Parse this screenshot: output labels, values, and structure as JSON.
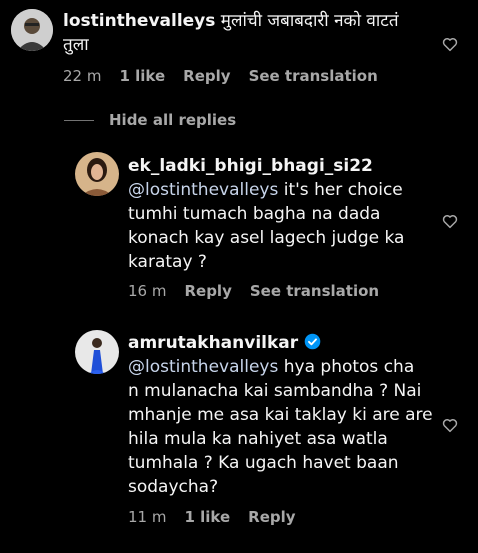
{
  "comment": {
    "username": "lostinthevalleys",
    "text_inline": "मुलांची जबाबदारी नको वाटतं",
    "text_line2": "तुला",
    "time": "22 m",
    "likes": "1 like",
    "reply_label": "Reply",
    "translate_label": "See translation"
  },
  "replies_toggle": {
    "label": "Hide all replies"
  },
  "replies": [
    {
      "username": "ek_ladki_bhigi_bhagi_si22",
      "mention": "@lostinthevalleys",
      "text_first": " it's her choice",
      "lines": [
        "tumhi tumach bagha na dada",
        "konach kay asel lagech judge ka",
        "karatay ?"
      ],
      "time": "16 m",
      "reply_label": "Reply",
      "translate_label": "See translation"
    },
    {
      "username": "amrutakhanvilkar",
      "verified": true,
      "mention": "@lostinthevalleys",
      "text_first": " hya photos cha",
      "lines": [
        "n mulanacha kai sambandha ? Nai",
        "mhanje me asa kai taklay ki are are",
        "hila mula ka nahiyet asa watla",
        "tumhala ? Ka ugach havet baan",
        "sodaycha?"
      ],
      "time": "11 m",
      "likes": "1 like",
      "reply_label": "Reply"
    }
  ],
  "colors": {
    "background": "#000000",
    "text": "#f5f5f5",
    "secondary": "#a8a8a8",
    "mention": "#c7d4ea",
    "verified": "#0095f6"
  }
}
